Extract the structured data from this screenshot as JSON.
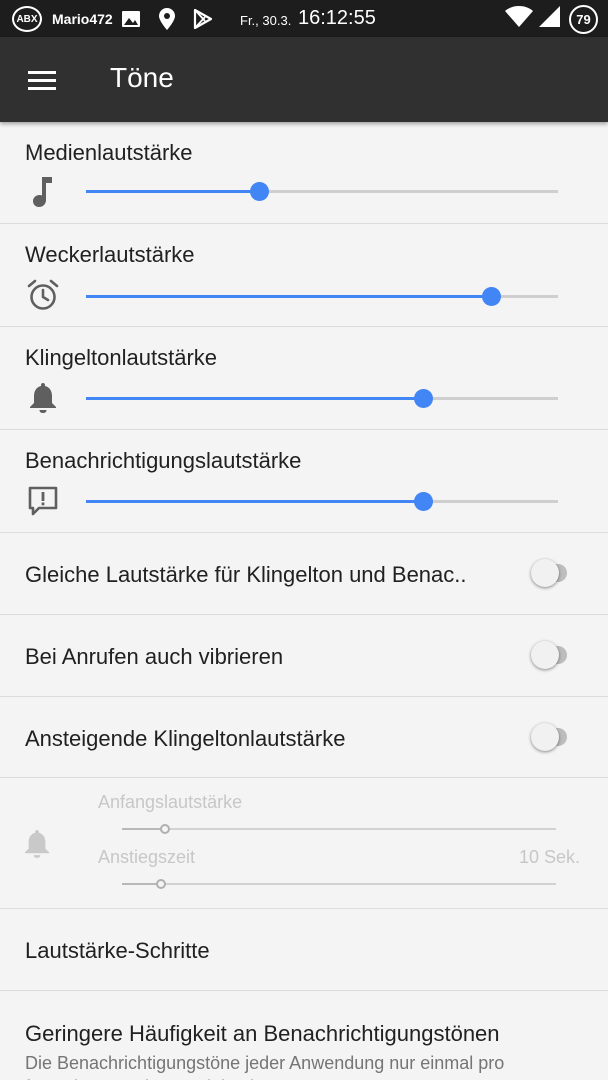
{
  "status_bar": {
    "logo_text": "ABX",
    "user": "Mario472",
    "icons": [
      "image-icon",
      "location-icon",
      "play-store-icon"
    ],
    "date": "Fr., 30.3.",
    "time": "16:12:55",
    "right_icons": [
      "wifi-icon",
      "signal-icon"
    ],
    "battery": "79"
  },
  "toolbar": {
    "menu_icon": "menu-icon",
    "title": "Töne"
  },
  "volume_sliders": [
    {
      "label": "Medienlautstärke",
      "icon": "music-note-icon",
      "level": 0.366
    },
    {
      "label": "Weckerlautstärke",
      "icon": "alarm-clock-icon",
      "level": 0.858
    },
    {
      "label": "Klingeltonlautstärke",
      "icon": "bell-icon",
      "level": 0.714
    },
    {
      "label": "Benachrichtigungslautstärke",
      "icon": "notification-alert-icon",
      "level": 0.714
    }
  ],
  "toggles": [
    {
      "label": "Gleiche Lautstärke für Klingelton und Benac..",
      "on": false
    },
    {
      "label": "Bei Anrufen auch vibrieren",
      "on": false
    },
    {
      "label": "Ansteigende Klingeltonlautstärke",
      "on": false
    }
  ],
  "escalating": {
    "icon": "bell-icon",
    "start_label": "Anfangslautstärke",
    "start_level": 0.1,
    "rise_label": "Anstiegszeit",
    "rise_value": "10 Sek.",
    "rise_level": 0.09
  },
  "volume_steps": {
    "label": "Lautstärke-Schritte"
  },
  "fewer_notifications": {
    "title": "Geringere Häufigkeit an Benachrichtigungstönen",
    "summary": "Die Benachrichtigungstöne jeder Anwendung nur einmal pro festgelegter Zeit ausspielen lassen"
  },
  "colors": {
    "accent": "#4285f4",
    "toolbar": "#303030",
    "status_bar": "#1d1d1d",
    "background": "#f4f4f4"
  }
}
